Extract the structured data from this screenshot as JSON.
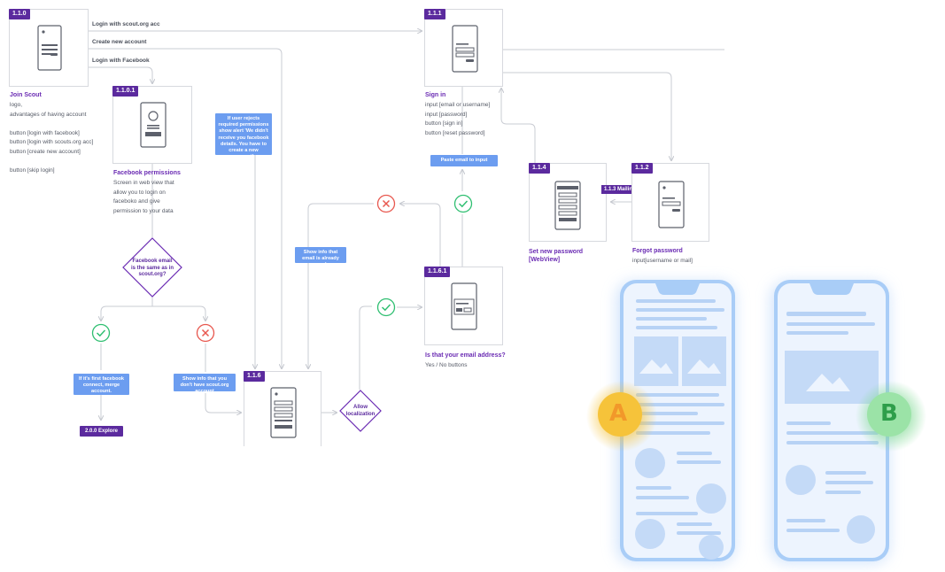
{
  "colors": {
    "purple": "#5b2a9e",
    "title_purple": "#6a2bb3",
    "note_blue": "#6c9df0",
    "yes_green": "#2fbf71",
    "no_red": "#e8584f",
    "badge_a": "#f6c33a",
    "badge_b": "#7dd891"
  },
  "nodes": {
    "join": {
      "tag": "1.1.0",
      "title": "Join Scout",
      "lines": [
        "logo,",
        "advantages of having account",
        "",
        "button [login with facebook]",
        "button [login with scouts.org acc]",
        "button [create new account]",
        "",
        "button [skip login]"
      ]
    },
    "fb": {
      "tag": "1.1.0.1",
      "title": "Facebook permissions",
      "lines": [
        "Screen in web view that",
        "allow you to login on",
        "faceboko and give",
        "permission to your data"
      ]
    },
    "signin": {
      "tag": "1.1.1",
      "title": "Sign in",
      "lines": [
        "input [email or username]",
        "input [password]",
        "button [sign in]",
        "button [reset password]"
      ]
    },
    "setpw": {
      "tag": "1.1.4",
      "title_lines": [
        "Set new password",
        "[WebView]"
      ]
    },
    "forgot": {
      "tag": "1.1.2",
      "title": "Forgot password",
      "lines": [
        "input[username or mail]"
      ]
    },
    "email": {
      "tag": "1.1.6.1",
      "title": "Is that your email address?",
      "lines": [
        "Yes / No buttons"
      ]
    },
    "create": {
      "tag": "1.1.6"
    }
  },
  "edge_labels": {
    "login_scout": "Login with scout.org acc",
    "create_new": "Create new account",
    "login_fb": "Login with Facebook"
  },
  "notes": {
    "reject": "If user rejects required permissions show alert 'We didn't receive you facebook details. You have to create a new account!",
    "paste": "Paste email to input",
    "already_used": "Show info that email is already used",
    "first_fb": "If it's first facebook connect, merge account.",
    "no_account": "Show info that you don't have scout.org account"
  },
  "decisions": {
    "fb_email": [
      "Facebook email",
      "is the same as in",
      "scout.org?"
    ],
    "localization": [
      "Allow",
      "localization"
    ]
  },
  "buttons": {
    "explore": "2.0.0 Explore",
    "mailing": "1.1.3 Mailing"
  },
  "badges": {
    "a": "A",
    "b": "B"
  }
}
